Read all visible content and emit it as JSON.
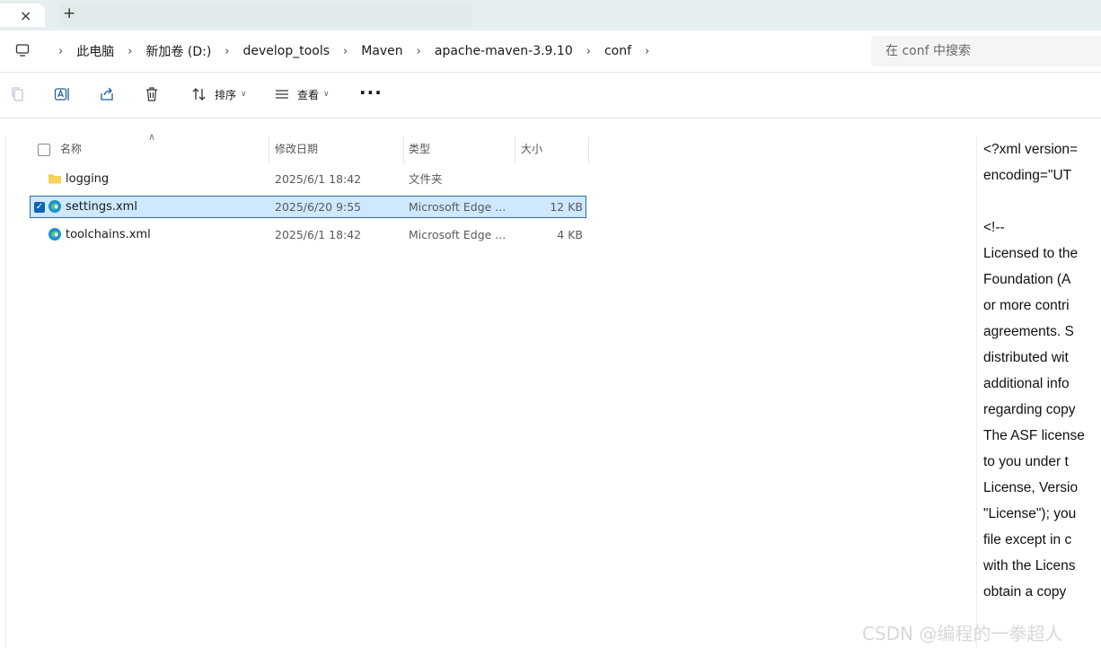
{
  "tabs": {
    "close_glyph": "×",
    "new_tab_glyph": "+"
  },
  "breadcrumb": [
    "此电脑",
    "新加卷 (D:)",
    "develop_tools",
    "Maven",
    "apache-maven-3.9.10",
    "conf"
  ],
  "search": {
    "placeholder": "在 conf 中搜索"
  },
  "toolbar": {
    "sort_label": "排序",
    "view_label": "查看",
    "more_label": "···"
  },
  "columns": {
    "name": "名称",
    "date": "修改日期",
    "type": "类型",
    "size": "大小"
  },
  "files": [
    {
      "name": "logging",
      "date": "2025/6/1 18:42",
      "type": "文件夹",
      "size": "",
      "icon": "folder-icon",
      "selected": false
    },
    {
      "name": "settings.xml",
      "date": "2025/6/20 9:55",
      "type": "Microsoft Edge ...",
      "size": "12 KB",
      "icon": "edge-icon",
      "selected": true
    },
    {
      "name": "toolchains.xml",
      "date": "2025/6/1 18:42",
      "type": "Microsoft Edge ...",
      "size": "4 KB",
      "icon": "edge-icon",
      "selected": false
    }
  ],
  "preview_lines": [
    "<?xml version=",
    "encoding=\"UT",
    "",
    "<!--",
    "Licensed to the",
    "Foundation (A",
    "or more contri",
    "agreements.  S",
    "distributed wit",
    "additional info",
    "regarding copy",
    "The ASF license",
    "to you under t",
    "License, Versio",
    "\"License\"); you",
    "file except in c",
    "with the Licens",
    "obtain a copy"
  ],
  "watermark": "CSDN @编程的一拳超人",
  "colors": {
    "selection_bg": "#cde8ff",
    "selection_border": "#2c6aa8",
    "folder": "#f2c744",
    "edge": "#1e8fd6"
  }
}
